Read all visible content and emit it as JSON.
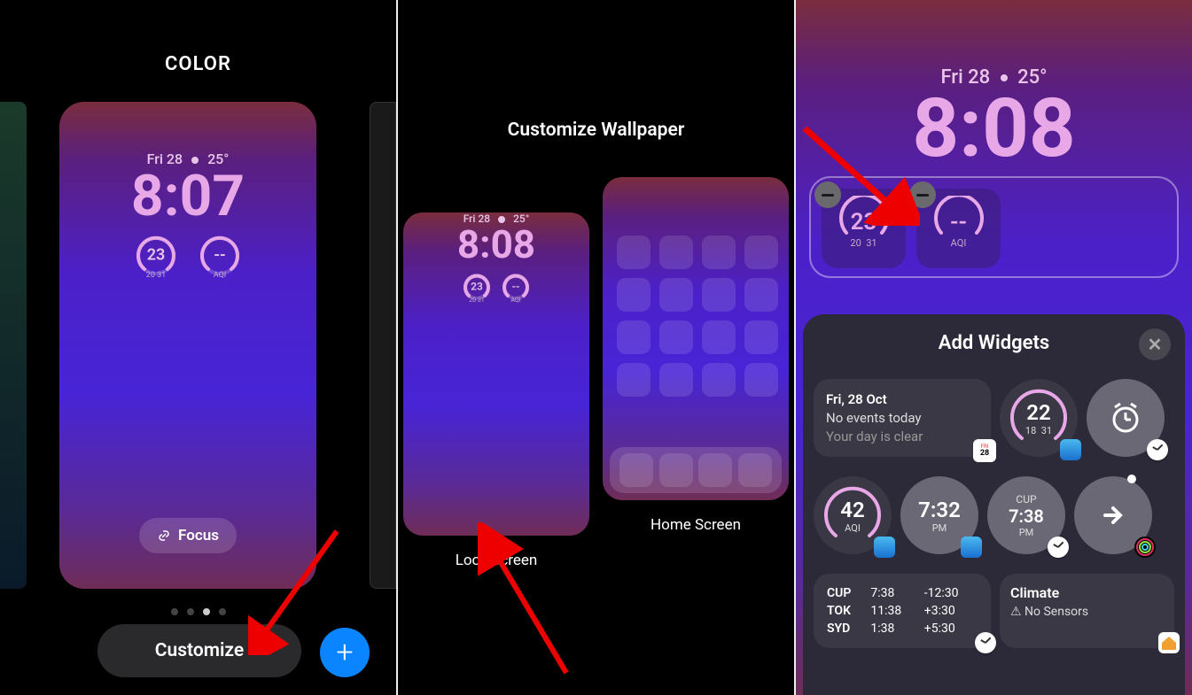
{
  "panel1": {
    "title": "COLOR",
    "date": "Fri 28",
    "temp": "25°",
    "time": "8:07",
    "widget_temp": {
      "value": "23",
      "low": "20",
      "high": "31"
    },
    "widget_aqi": {
      "value": "--",
      "label": "AQI"
    },
    "focus_label": "Focus",
    "customize_label": "Customize"
  },
  "panel2": {
    "title": "Customize Wallpaper",
    "date": "Fri 28",
    "temp": "25°",
    "time": "8:08",
    "widget_temp": {
      "value": "23",
      "low": "20",
      "high": "31"
    },
    "widget_aqi": {
      "value": "--",
      "label": "AQI"
    },
    "lock_label": "Lock Screen",
    "home_label": "Home Screen"
  },
  "panel3": {
    "date": "Fri 28",
    "temp": "25°",
    "time": "8:08",
    "slot1": {
      "value": "23",
      "low": "20",
      "high": "31"
    },
    "slot2": {
      "value": "--",
      "label": "AQI"
    },
    "sheet_title": "Add Widgets",
    "calendar": {
      "date": "Fri, 28 Oct",
      "events": "No events today",
      "clear": "Your day is clear",
      "badge": "28",
      "badge_top": "FRI"
    },
    "temp_widget": {
      "value": "22",
      "low": "18",
      "high": "31"
    },
    "aqi_widget": {
      "value": "42",
      "label": "AQI"
    },
    "sunrise": {
      "time": "7:32",
      "pm": "PM"
    },
    "cup_clock": {
      "city": "CUP",
      "time": "7:38",
      "pm": "PM"
    },
    "clocks": [
      {
        "city": "CUP",
        "time": "7:38",
        "offset": "-12:30"
      },
      {
        "city": "TOK",
        "time": "11:38",
        "offset": "+3:30"
      },
      {
        "city": "SYD",
        "time": "1:38",
        "offset": "+5:30"
      }
    ],
    "climate": {
      "title": "Climate",
      "sub": "No Sensors"
    }
  }
}
